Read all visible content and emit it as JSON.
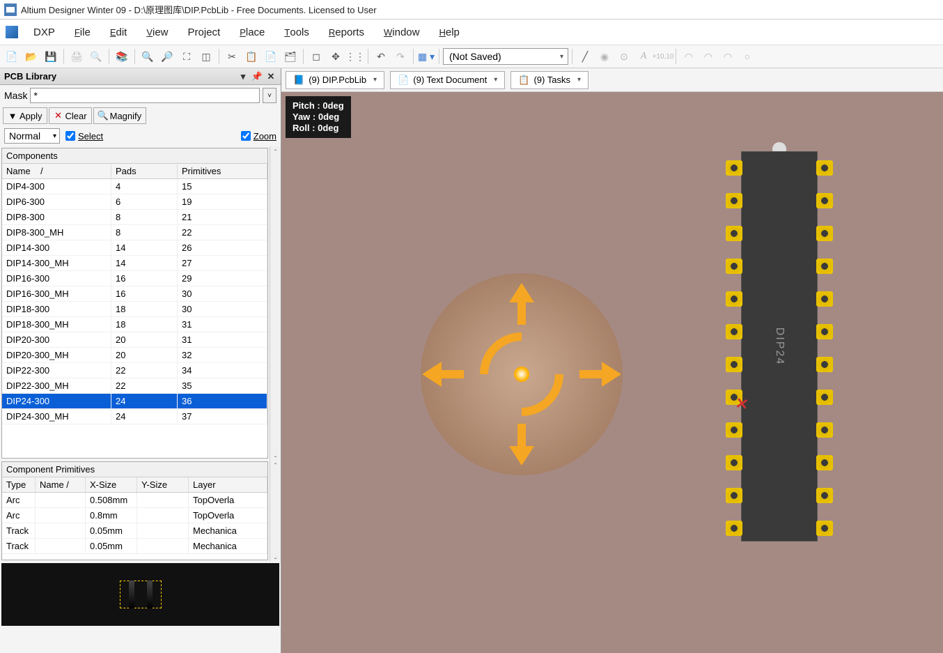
{
  "title": "Altium Designer Winter 09 - D:\\原理图库\\DIP.PcbLib - Free Documents. Licensed to User",
  "menu": [
    "DXP",
    "File",
    "Edit",
    "View",
    "Project",
    "Place",
    "Tools",
    "Reports",
    "Window",
    "Help"
  ],
  "menu_underline": [
    "",
    "F",
    "E",
    "V",
    "",
    "P",
    "T",
    "R",
    "W",
    "H"
  ],
  "toolbar_combo": "(Not Saved)",
  "panel": {
    "title": "PCB Library",
    "mask_label": "Mask",
    "mask_value": "*",
    "apply": "Apply",
    "clear": "Clear",
    "magnify": "Magnify",
    "mode": "Normal",
    "select": "Select",
    "zoom": "Zoom"
  },
  "components": {
    "title": "Components",
    "headers": [
      "Name",
      "Pads",
      "Primitives"
    ],
    "rows": [
      {
        "name": "DIP4-300",
        "pads": "4",
        "prim": "15",
        "sel": false
      },
      {
        "name": "DIP6-300",
        "pads": "6",
        "prim": "19",
        "sel": false
      },
      {
        "name": "DIP8-300",
        "pads": "8",
        "prim": "21",
        "sel": false
      },
      {
        "name": "DIP8-300_MH",
        "pads": "8",
        "prim": "22",
        "sel": false
      },
      {
        "name": "DIP14-300",
        "pads": "14",
        "prim": "26",
        "sel": false
      },
      {
        "name": "DIP14-300_MH",
        "pads": "14",
        "prim": "27",
        "sel": false
      },
      {
        "name": "DIP16-300",
        "pads": "16",
        "prim": "29",
        "sel": false
      },
      {
        "name": "DIP16-300_MH",
        "pads": "16",
        "prim": "30",
        "sel": false
      },
      {
        "name": "DIP18-300",
        "pads": "18",
        "prim": "30",
        "sel": false
      },
      {
        "name": "DIP18-300_MH",
        "pads": "18",
        "prim": "31",
        "sel": false
      },
      {
        "name": "DIP20-300",
        "pads": "20",
        "prim": "31",
        "sel": false
      },
      {
        "name": "DIP20-300_MH",
        "pads": "20",
        "prim": "32",
        "sel": false
      },
      {
        "name": "DIP22-300",
        "pads": "22",
        "prim": "34",
        "sel": false
      },
      {
        "name": "DIP22-300_MH",
        "pads": "22",
        "prim": "35",
        "sel": false
      },
      {
        "name": "DIP24-300",
        "pads": "24",
        "prim": "36",
        "sel": true
      },
      {
        "name": "DIP24-300_MH",
        "pads": "24",
        "prim": "37",
        "sel": false
      }
    ]
  },
  "primitives": {
    "title": "Component Primitives",
    "headers": [
      "Type",
      "Name",
      "X-Size",
      "Y-Size",
      "Layer"
    ],
    "rows": [
      {
        "type": "Arc",
        "name": "",
        "xs": "0.508mm",
        "ys": "",
        "layer": "TopOverla"
      },
      {
        "type": "Arc",
        "name": "",
        "xs": "0.8mm",
        "ys": "",
        "layer": "TopOverla"
      },
      {
        "type": "Track",
        "name": "",
        "xs": "0.05mm",
        "ys": "",
        "layer": "Mechanica"
      },
      {
        "type": "Track",
        "name": "",
        "xs": "0.05mm",
        "ys": "",
        "layer": "Mechanica"
      }
    ]
  },
  "tabs": [
    "(9) DIP.PcbLib",
    "(9) Text Document",
    "(9) Tasks"
  ],
  "hud": {
    "pitch": "Pitch : 0deg",
    "yaw": "Yaw  : 0deg",
    "roll": "Roll  : 0deg"
  },
  "chip_label": "DIP24",
  "pins_per_side": 12
}
